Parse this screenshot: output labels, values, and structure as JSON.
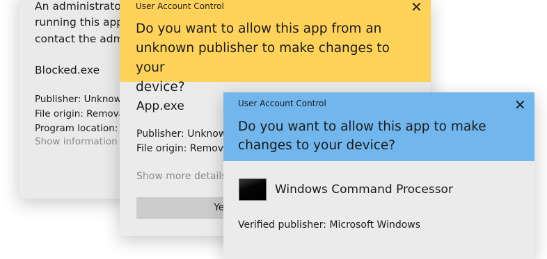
{
  "dialog_blocked": {
    "message_lines": [
      "An administrato",
      "running this app",
      "contact the adm"
    ],
    "filename": "Blocked.exe",
    "publisher": "Publisher: Unknow",
    "file_origin": "File origin: Remova",
    "program_location": "Program location:",
    "show_information": "Show information"
  },
  "dialog_unknown": {
    "caption": "User Account Control",
    "close_glyph": "✕",
    "question_lines": [
      "Do you want to allow this app from an",
      "unknown publisher to make changes to your",
      "device?"
    ],
    "header_color": "#ffd35a",
    "filename": "App.exe",
    "publisher": "Publisher: Unknown",
    "file_origin": "File origin: Remova",
    "show_more": "Show more details",
    "yes_label": "Yes"
  },
  "dialog_verified": {
    "caption": "User Account Control",
    "close_glyph": "✕",
    "question_lines": [
      "Do you want to allow this app to make",
      "changes to your device?"
    ],
    "header_color": "#72b6ee",
    "app_icon": "console-icon",
    "app_name": "Windows Command Processor",
    "verified_publisher": "Verified publisher: Microsoft Windows"
  }
}
